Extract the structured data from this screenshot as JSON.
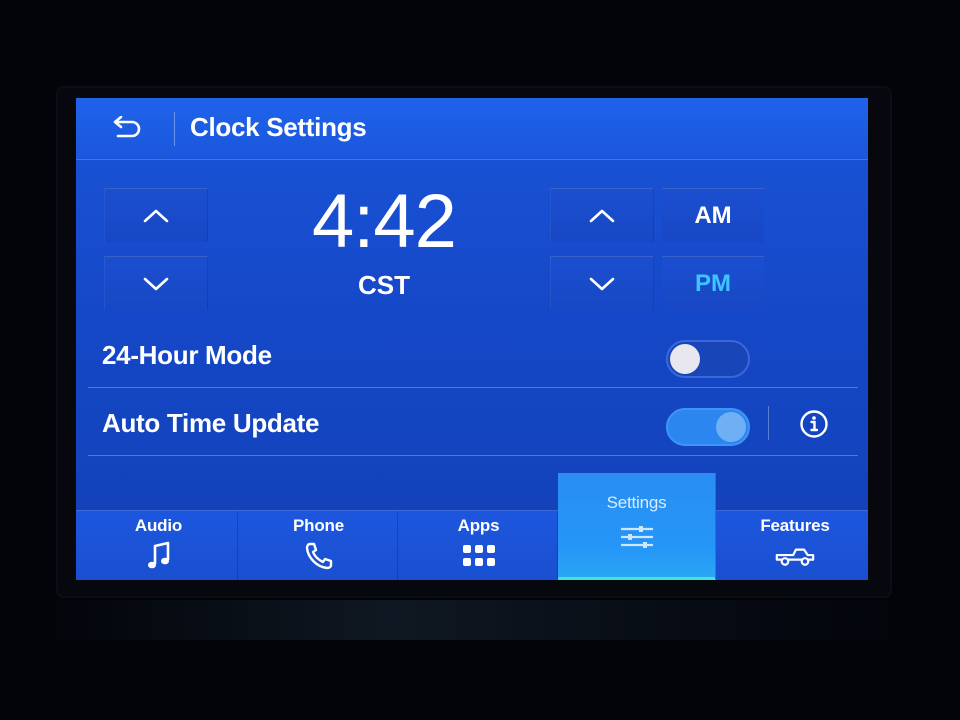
{
  "header": {
    "title": "Clock Settings",
    "back_icon": "back-arrow-icon"
  },
  "clock": {
    "time": "4:42",
    "timezone": "CST",
    "am_label": "AM",
    "pm_label": "PM",
    "selected_period": "PM",
    "selected_color": "#3ec4ff"
  },
  "settings": {
    "hour24": {
      "label": "24-Hour Mode",
      "enabled": false
    },
    "auto_time": {
      "label": "Auto Time Update",
      "enabled": true,
      "info_icon": "info-icon"
    }
  },
  "nav": {
    "items": [
      {
        "label": "Audio",
        "icon": "music-note-icon",
        "active": false
      },
      {
        "label": "Phone",
        "icon": "phone-icon",
        "active": false
      },
      {
        "label": "Apps",
        "icon": "apps-grid-icon",
        "active": false
      },
      {
        "label": "Settings",
        "icon": "sliders-icon",
        "active": true
      },
      {
        "label": "Features",
        "icon": "truck-icon",
        "active": false
      }
    ]
  },
  "colors": {
    "screen_blue": "#1548c8",
    "active_tab": "#2595f7",
    "active_underline": "#3fe3d9"
  }
}
